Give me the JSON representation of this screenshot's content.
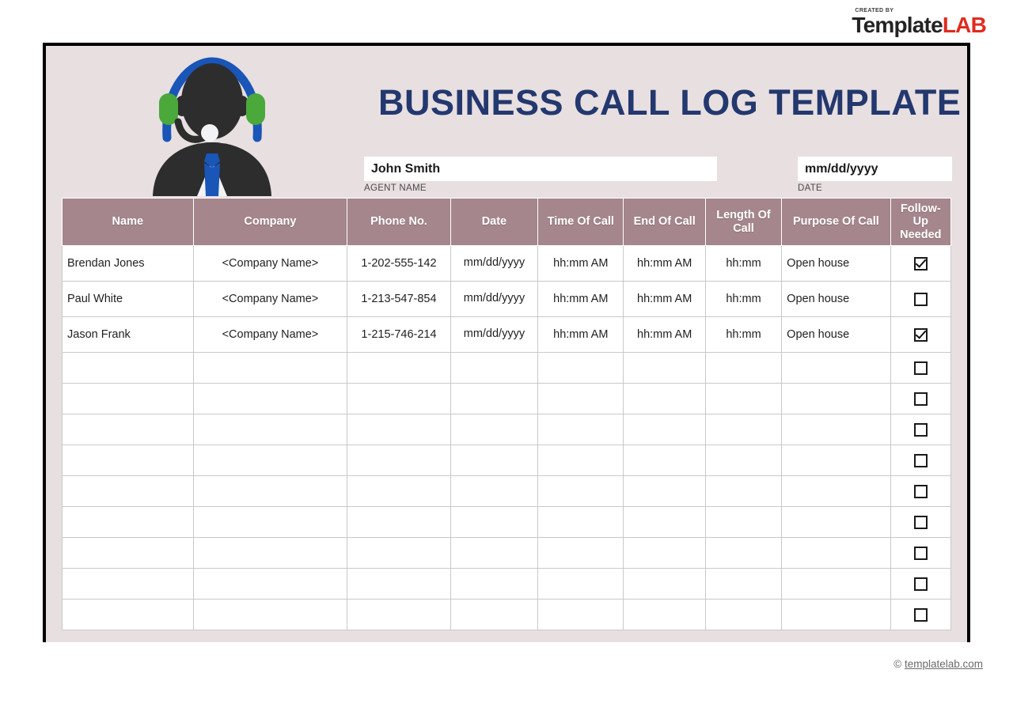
{
  "branding": {
    "created_by": "CREATED BY",
    "name_part1": "Template",
    "name_part2": "LAB",
    "accent_red": "#e02b20",
    "dark": "#232323"
  },
  "document": {
    "title": "BUSINESS CALL LOG TEMPLATE",
    "title_color": "#23386e",
    "page_background": "#e8dfe1",
    "border_color": "#000000"
  },
  "illustration": {
    "icon_name": "call-center-agent-icon",
    "headband_color": "#1a55b8",
    "earcup_color": "#4aa93a",
    "figure_color": "#2d2d2d",
    "tie_color": "#1a55b8",
    "shirt_color": "#f2f3f5"
  },
  "fields": {
    "agent": {
      "value": "John Smith",
      "placeholder": "John Smith",
      "label": "AGENT NAME"
    },
    "date": {
      "value": "mm/dd/yyyy",
      "placeholder": "mm/dd/yyyy",
      "label": "DATE"
    }
  },
  "table": {
    "header_background": "#a4868c",
    "columns": [
      "Name",
      "Company",
      "Phone No.",
      "Date",
      "Time Of Call",
      "End Of Call",
      "Length Of Call",
      "Purpose Of Call",
      "Follow-Up Needed"
    ],
    "rows": [
      {
        "name": "Brendan Jones",
        "company": "<Company Name>",
        "phone": "1-202-555-142",
        "date": "mm/dd/yyyy",
        "time_of_call": "hh:mm AM",
        "end_of_call": "hh:mm AM",
        "length_of_call": "hh:mm",
        "purpose": "Open house",
        "follow_up": true
      },
      {
        "name": "Paul White",
        "company": "<Company Name>",
        "phone": "1-213-547-854",
        "date": "mm/dd/yyyy",
        "time_of_call": "hh:mm AM",
        "end_of_call": "hh:mm AM",
        "length_of_call": "hh:mm",
        "purpose": "Open house",
        "follow_up": false
      },
      {
        "name": "Jason Frank",
        "company": "<Company Name>",
        "phone": "1-215-746-214",
        "date": "mm/dd/yyyy",
        "time_of_call": "hh:mm AM",
        "end_of_call": "hh:mm AM",
        "length_of_call": "hh:mm",
        "purpose": "Open house",
        "follow_up": true
      }
    ],
    "empty_row_count": 9
  },
  "footer": {
    "copyright_symbol": "©",
    "domain": "templatelab.com"
  }
}
